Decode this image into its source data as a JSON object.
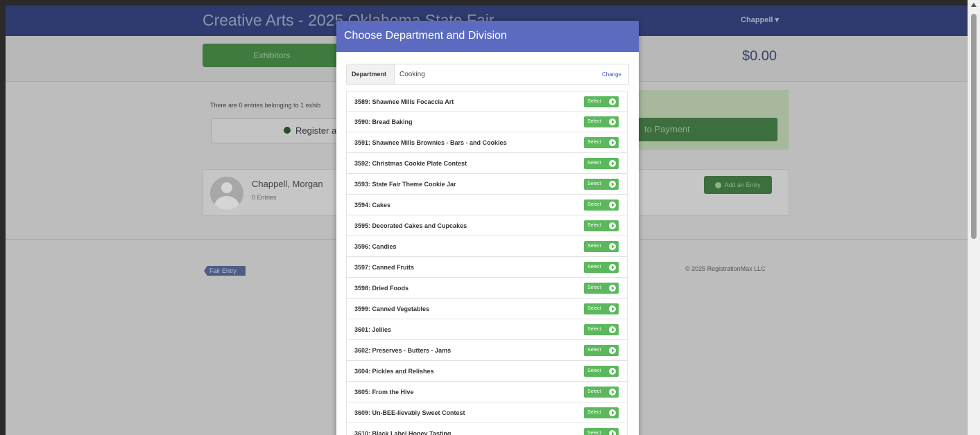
{
  "header": {
    "title": "Creative Arts - 2025 Oklahoma State Fair",
    "user_menu": "Chappell ▾"
  },
  "subnav": {
    "exhibitors_label": "Exhibitors",
    "total": "$0.00"
  },
  "summary": {
    "info_text": "There are 0 entries belonging to 1 exhib",
    "register_label": "Register a",
    "payment_label": "to Payment"
  },
  "exhibitor": {
    "name": "Chappell, Morgan",
    "entries": "0 Entries",
    "add_entry_label": "Add an Entry"
  },
  "footer": {
    "logo_text": "Fair Entry",
    "copyright": "© 2025 RegistrationMax LLC"
  },
  "modal": {
    "title": "Choose Department and Division",
    "department_label": "Department",
    "department_value": "Cooking",
    "change_label": "Change",
    "select_label": "Select",
    "divisions": [
      "3589: Shawnee Mills Focaccia Art",
      "3590: Bread Baking",
      "3591: Shawnee Mills Brownies - Bars - and Cookies",
      "3592: Christmas Cookie Plate Contest",
      "3593: State Fair Theme Cookie Jar",
      "3594: Cakes",
      "3595: Decorated Cakes and Cupcakes",
      "3596: Candies",
      "3597: Canned Fruits",
      "3598: Dried Foods",
      "3599: Canned Vegetables",
      "3601: Jellies",
      "3602: Preserves - Butters - Jams",
      "3604: Pickles and Relishes",
      "3605: From the Hive",
      "3609: Un-BEE-lievably Sweet Contest",
      "3610: Black Label Honey Tasting"
    ]
  }
}
